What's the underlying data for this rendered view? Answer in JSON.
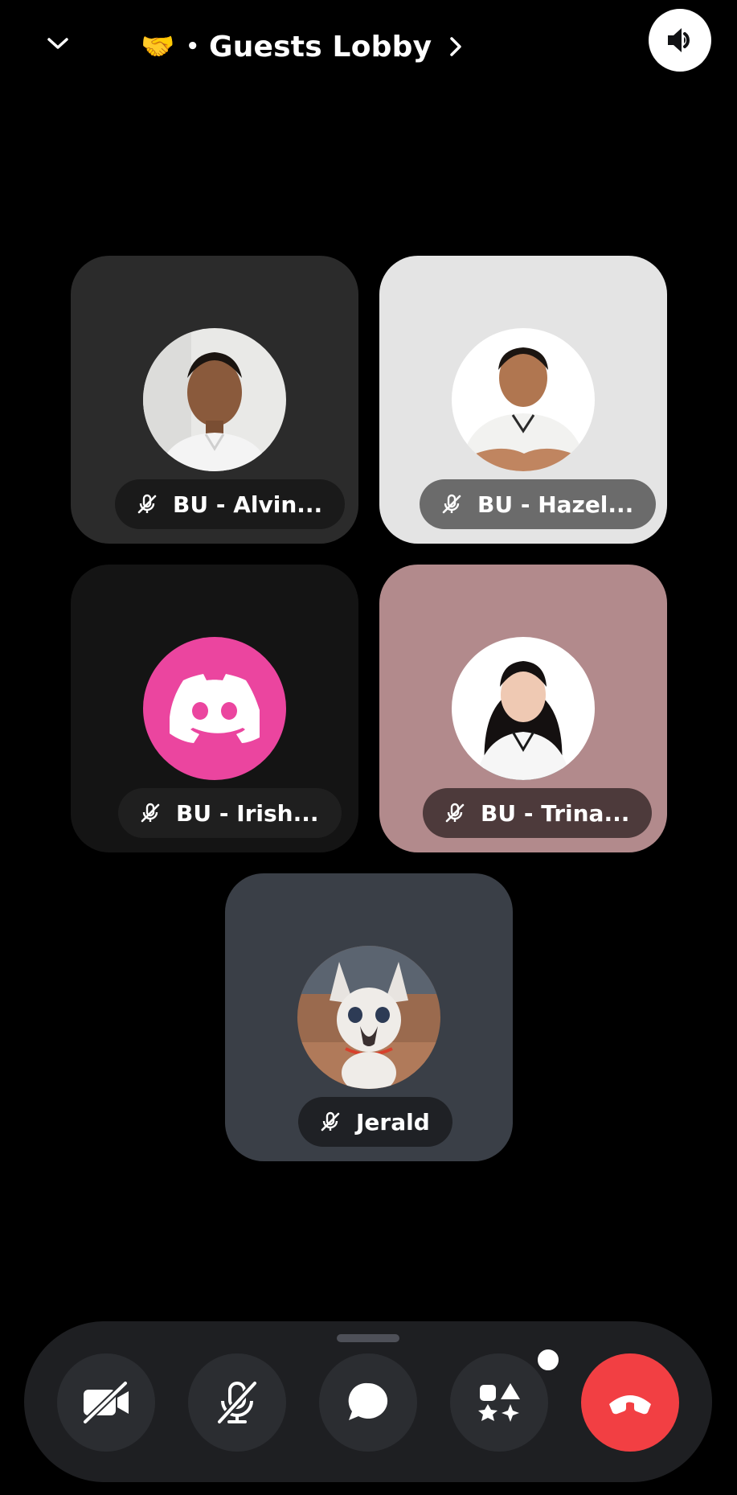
{
  "header": {
    "emoji": "🤝",
    "separator": "•",
    "title": "Guests Lobby"
  },
  "participants": [
    {
      "name": "BU - Alvin...",
      "muted": true,
      "tile_color": "#2b2b2b",
      "avatar": "photo"
    },
    {
      "name": "BU - Hazel...",
      "muted": true,
      "tile_color": "#e4e4e4",
      "avatar": "photo"
    },
    {
      "name": "BU - Irish...",
      "muted": true,
      "tile_color": "#141414",
      "avatar": "discord-logo",
      "avatar_color": "#eb459f"
    },
    {
      "name": "BU - Trina...",
      "muted": true,
      "tile_color": "#b28a8c",
      "avatar": "photo"
    },
    {
      "name": "Jerald",
      "muted": true,
      "tile_color": "#3a3f47",
      "avatar": "photo-cat"
    }
  ],
  "controls": [
    {
      "icon": "camera-off-icon"
    },
    {
      "icon": "mic-off-icon"
    },
    {
      "icon": "chat-icon"
    },
    {
      "icon": "activities-icon",
      "has_notification": true
    },
    {
      "icon": "hang-up-icon",
      "color": "#f23f43"
    }
  ],
  "colors": {
    "background": "#000000",
    "controlbar": "#1e1f22",
    "button": "#2b2d31",
    "hangup": "#f23f43"
  }
}
